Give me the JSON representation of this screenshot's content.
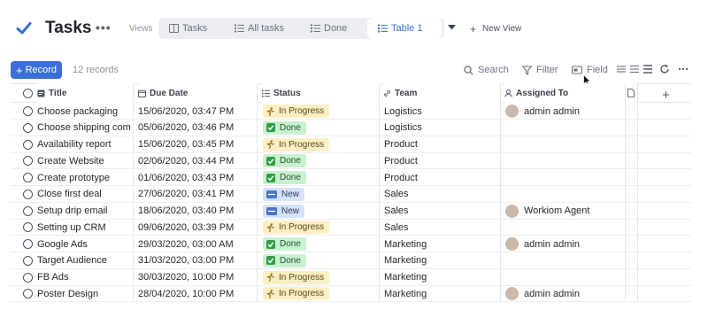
{
  "app": {
    "title": "Tasks",
    "more": "•••",
    "accent": "#3a6fd8"
  },
  "views": {
    "label": "Views",
    "tabs": [
      {
        "label": "Tasks",
        "icon": "grid-icon"
      },
      {
        "label": "All tasks",
        "icon": "list-icon"
      },
      {
        "label": "Done",
        "icon": "list-icon"
      },
      {
        "label": "Table 1",
        "icon": "list-icon",
        "active": true
      }
    ],
    "new_view": "New View"
  },
  "toolbar": {
    "record_label": "Record",
    "record_count": "12 records",
    "search": "Search",
    "filter": "Filter",
    "field": "Field"
  },
  "table": {
    "columns": [
      "Title",
      "Due Date",
      "Status",
      "Team",
      "Assigned To"
    ],
    "rows": [
      {
        "title": "Choose packaging",
        "due": "15/06/2020, 03:47 PM",
        "status": "In Progress",
        "team": "Logistics",
        "assigned": "admin admin"
      },
      {
        "title": "Choose shipping com…",
        "due": "05/06/2020, 03:46 PM",
        "status": "Done",
        "team": "Logistics",
        "assigned": ""
      },
      {
        "title": "Availability report",
        "due": "15/06/2020, 03:45 PM",
        "status": "In Progress",
        "team": "Product",
        "assigned": ""
      },
      {
        "title": "Create Website",
        "due": "02/06/2020, 03:44 PM",
        "status": "Done",
        "team": "Product",
        "assigned": ""
      },
      {
        "title": "Create prototype",
        "due": "01/06/2020, 03:43 PM",
        "status": "Done",
        "team": "Product",
        "assigned": ""
      },
      {
        "title": "Close first deal",
        "due": "27/06/2020, 03:41 PM",
        "status": "New",
        "team": "Sales",
        "assigned": ""
      },
      {
        "title": "Setup drip email",
        "due": "18/06/2020, 03:40 PM",
        "status": "New",
        "team": "Sales",
        "assigned": "Workiom Agent"
      },
      {
        "title": "Setting up CRM",
        "due": "09/06/2020, 03:39 PM",
        "status": "In Progress",
        "team": "Sales",
        "assigned": ""
      },
      {
        "title": "Google Ads",
        "due": "29/03/2020, 03:00 AM",
        "status": "Done",
        "team": "Marketing",
        "assigned": "admin admin"
      },
      {
        "title": "Target Audience",
        "due": "31/03/2020, 03:00 PM",
        "status": "Done",
        "team": "Marketing",
        "assigned": ""
      },
      {
        "title": "FB Ads",
        "due": "30/03/2020, 10:00 PM",
        "status": "In Progress",
        "team": "Marketing",
        "assigned": ""
      },
      {
        "title": "Poster Design",
        "due": "28/04/2020, 10:00 PM",
        "status": "In Progress",
        "team": "Marketing",
        "assigned": "admin admin"
      }
    ]
  },
  "status_colors": {
    "In Progress": {
      "bg": "#fdeec3",
      "fg": "#5a4a1a"
    },
    "Done": {
      "bg": "#c9f0cf",
      "fg": "#1e5a2b"
    },
    "New": {
      "bg": "#d5e2f7",
      "fg": "#2a3f66"
    }
  }
}
